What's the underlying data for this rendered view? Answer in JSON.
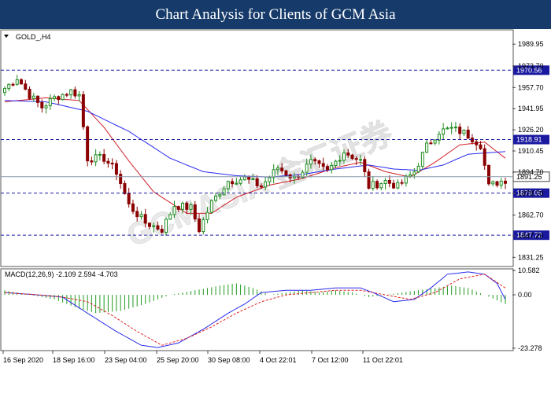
{
  "header": {
    "title": "Chart Analysis for Clients of GCM Asia"
  },
  "watermark": {
    "text": "GCMASIA 金汇证券"
  },
  "main_chart": {
    "symbol_label": "GOLD_,H4",
    "ylim": [
      1825,
      2000
    ],
    "y_ticks": [
      "1989.95",
      "1973.70",
      "1957.70",
      "1941.95",
      "1926.20",
      "1910.45",
      "1894.70",
      "1878.70",
      "1862.70",
      "1847.20",
      "1831.25"
    ],
    "levels": [
      {
        "value": 1970.56,
        "label": "1970.56"
      },
      {
        "value": 1918.91,
        "label": "1918.91"
      },
      {
        "value": 1879.05,
        "label": "1879.05"
      },
      {
        "value": 1847.72,
        "label": "1847.72"
      }
    ],
    "current_price": {
      "value": 1891.25,
      "label": "1891.25"
    }
  },
  "macd_panel": {
    "label": "MACD(12,26,9) -2.109 2.594 -4.703",
    "y_ticks": [
      "10.582",
      "0.00",
      "-23.278"
    ],
    "ylim": [
      -24,
      11
    ]
  },
  "x_axis": {
    "labels": [
      "16 Sep 2020",
      "18 Sep 16:00",
      "23 Sep 04:00",
      "25 Sep 20:00",
      "30 Sep 08:00",
      "4 Oct 22:01",
      "7 Oct 12:00",
      "11 Oct 22:01"
    ]
  },
  "colors": {
    "header_bg": "#163b6a",
    "bull": "#1f8c1f",
    "bear": "#8b0000",
    "ma_fast": "#d0202a",
    "ma_slow": "#2a2aee",
    "level_line": "#1a1aa0",
    "level_box": "#1a1aa0",
    "macd_hist": "#1f9b1f",
    "macd_line": "#2a2aee",
    "signal_line": "#e02020"
  },
  "chart_data": {
    "type": "candlestick",
    "symbol": "GOLD_",
    "timeframe": "H4",
    "anchors_close": [
      [
        0,
        1957
      ],
      [
        3,
        1965
      ],
      [
        6,
        1952
      ],
      [
        9,
        1943
      ],
      [
        12,
        1950
      ],
      [
        16,
        1955
      ],
      [
        18,
        1952
      ],
      [
        20,
        1905
      ],
      [
        24,
        1905
      ],
      [
        27,
        1895
      ],
      [
        30,
        1870
      ],
      [
        34,
        1857
      ],
      [
        38,
        1852
      ],
      [
        41,
        1870
      ],
      [
        45,
        1868
      ],
      [
        47,
        1852
      ],
      [
        50,
        1872
      ],
      [
        54,
        1888
      ],
      [
        58,
        1890
      ],
      [
        62,
        1884
      ],
      [
        66,
        1898
      ],
      [
        70,
        1890
      ],
      [
        74,
        1902
      ],
      [
        78,
        1895
      ],
      [
        82,
        1910
      ],
      [
        86,
        1903
      ],
      [
        88,
        1884
      ],
      [
        92,
        1888
      ],
      [
        95,
        1884
      ],
      [
        99,
        1895
      ],
      [
        102,
        1914
      ],
      [
        105,
        1925
      ],
      [
        108,
        1927
      ],
      [
        111,
        1924
      ],
      [
        113,
        1920
      ],
      [
        115,
        1915
      ],
      [
        117,
        1884
      ],
      [
        119,
        1887
      ],
      [
        121,
        1889
      ]
    ],
    "moving_averages": [
      {
        "name": "MA fast",
        "points": [
          [
            0,
            1947
          ],
          [
            10,
            1950
          ],
          [
            18,
            1948
          ],
          [
            24,
            1928
          ],
          [
            30,
            1903
          ],
          [
            36,
            1880
          ],
          [
            44,
            1864
          ],
          [
            50,
            1864
          ],
          [
            56,
            1876
          ],
          [
            64,
            1885
          ],
          [
            72,
            1890
          ],
          [
            80,
            1898
          ],
          [
            86,
            1902
          ],
          [
            92,
            1895
          ],
          [
            98,
            1891
          ],
          [
            104,
            1902
          ],
          [
            110,
            1915
          ],
          [
            116,
            1917
          ],
          [
            121,
            1905
          ]
        ]
      },
      {
        "name": "MA slow",
        "points": [
          [
            0,
            1948
          ],
          [
            10,
            1947
          ],
          [
            20,
            1940
          ],
          [
            30,
            1925
          ],
          [
            40,
            1905
          ],
          [
            48,
            1895
          ],
          [
            56,
            1892
          ],
          [
            64,
            1891
          ],
          [
            72,
            1893
          ],
          [
            80,
            1897
          ],
          [
            88,
            1900
          ],
          [
            94,
            1897
          ],
          [
            100,
            1896
          ],
          [
            106,
            1900
          ],
          [
            112,
            1908
          ],
          [
            121,
            1910
          ]
        ]
      }
    ],
    "horizontal_levels": [
      1970.56,
      1918.91,
      1879.05,
      1847.72
    ],
    "current_price": 1891.25,
    "macd": {
      "params": "12,26,9",
      "main": -2.109,
      "signal": 2.594,
      "histogram": -4.703,
      "main_points": [
        [
          0,
          1
        ],
        [
          8,
          0
        ],
        [
          14,
          -1
        ],
        [
          20,
          -8
        ],
        [
          27,
          -16
        ],
        [
          33,
          -22
        ],
        [
          37,
          -23
        ],
        [
          42,
          -21
        ],
        [
          48,
          -15
        ],
        [
          54,
          -8
        ],
        [
          58,
          -4
        ],
        [
          62,
          1
        ],
        [
          68,
          2
        ],
        [
          74,
          2
        ],
        [
          80,
          3
        ],
        [
          86,
          3
        ],
        [
          89,
          1
        ],
        [
          94,
          -3
        ],
        [
          99,
          -2
        ],
        [
          103,
          3
        ],
        [
          107,
          9
        ],
        [
          112,
          10
        ],
        [
          116,
          9
        ],
        [
          119,
          5
        ],
        [
          121,
          -2
        ]
      ],
      "signal_points": [
        [
          0,
          1
        ],
        [
          8,
          0
        ],
        [
          14,
          -1
        ],
        [
          20,
          -3
        ],
        [
          26,
          -9
        ],
        [
          32,
          -16
        ],
        [
          38,
          -22
        ],
        [
          44,
          -19
        ],
        [
          50,
          -14
        ],
        [
          56,
          -8
        ],
        [
          62,
          -3
        ],
        [
          68,
          0
        ],
        [
          74,
          1
        ],
        [
          80,
          2
        ],
        [
          86,
          2
        ],
        [
          92,
          0
        ],
        [
          98,
          -2
        ],
        [
          104,
          1
        ],
        [
          110,
          7
        ],
        [
          116,
          9
        ],
        [
          121,
          3
        ]
      ],
      "histogram_points": [
        [
          0,
          2
        ],
        [
          6,
          0
        ],
        [
          12,
          -2
        ],
        [
          18,
          -6
        ],
        [
          22,
          -8
        ],
        [
          28,
          -7
        ],
        [
          34,
          -4
        ],
        [
          40,
          0
        ],
        [
          46,
          2
        ],
        [
          52,
          4
        ],
        [
          56,
          5
        ],
        [
          60,
          3
        ],
        [
          64,
          0
        ],
        [
          68,
          1
        ],
        [
          72,
          2
        ],
        [
          76,
          1
        ],
        [
          80,
          2
        ],
        [
          84,
          1
        ],
        [
          88,
          -1
        ],
        [
          92,
          0
        ],
        [
          96,
          1
        ],
        [
          100,
          2
        ],
        [
          104,
          3
        ],
        [
          108,
          4
        ],
        [
          112,
          3
        ],
        [
          116,
          0
        ],
        [
          121,
          -4
        ]
      ]
    }
  }
}
